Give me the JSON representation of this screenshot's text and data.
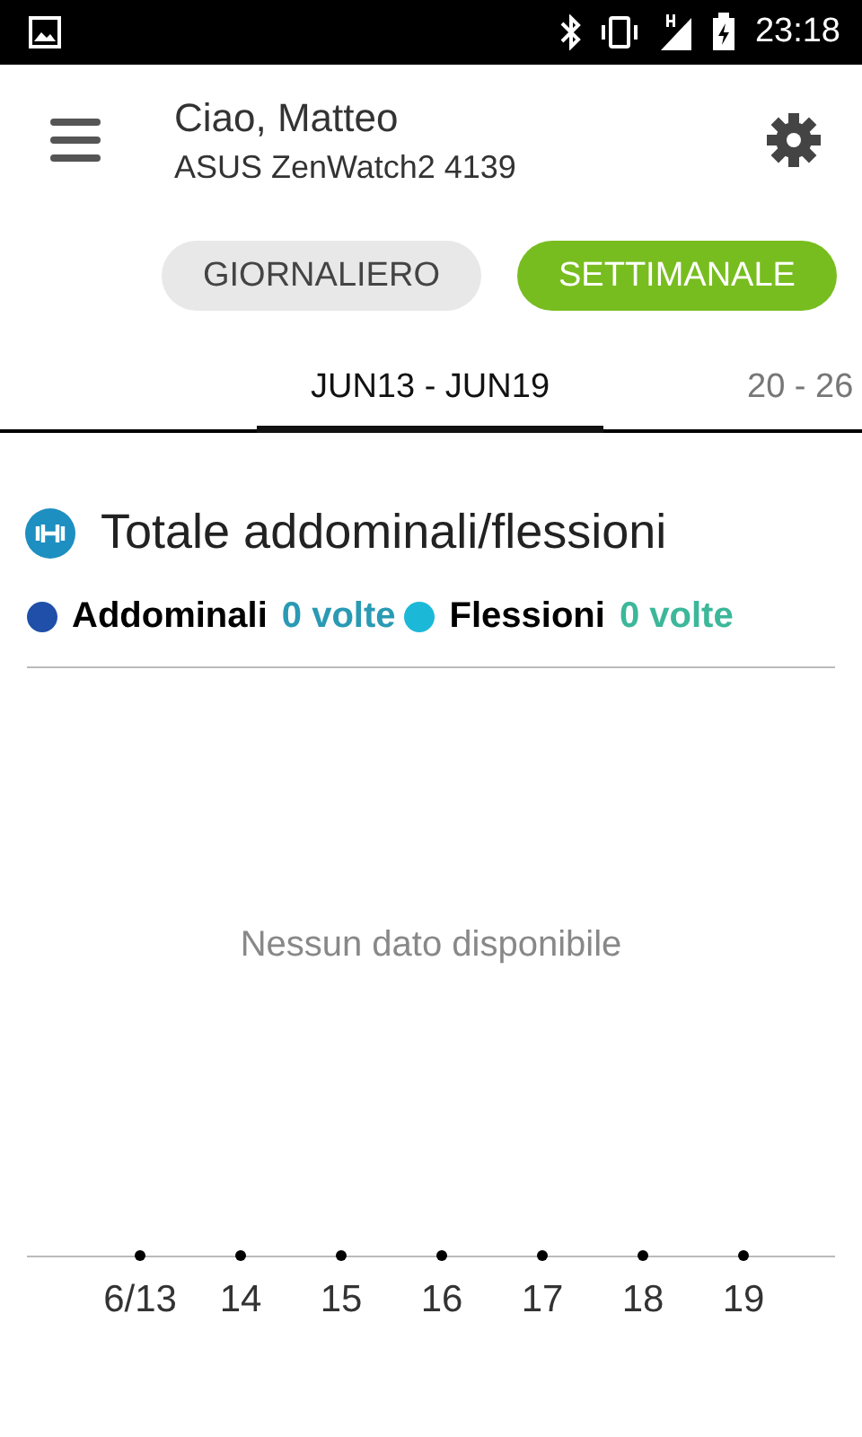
{
  "status_bar": {
    "time": "23:18"
  },
  "header": {
    "greeting": "Ciao, Matteo",
    "device": "ASUS ZenWatch2 4139"
  },
  "period_toggle": [
    {
      "label": "GIORNALIERO",
      "selected": false
    },
    {
      "label": "SETTIMANALE",
      "selected": true
    }
  ],
  "week_tabs": [
    {
      "label": "JUN13 - JUN19",
      "selected": true
    },
    {
      "label": "20 - 26",
      "selected": false
    }
  ],
  "card": {
    "title": "Totale addominali/flessioni",
    "legend": [
      {
        "name": "Addominali",
        "value": "0 volte",
        "color": "#1f4fa8"
      },
      {
        "name": "Flessioni",
        "value": "0 volte",
        "color": "#1cb8d8"
      }
    ],
    "empty_message": "Nessun dato disponibile",
    "x_labels": [
      "6/13",
      "14",
      "15",
      "16",
      "17",
      "18",
      "19"
    ]
  }
}
